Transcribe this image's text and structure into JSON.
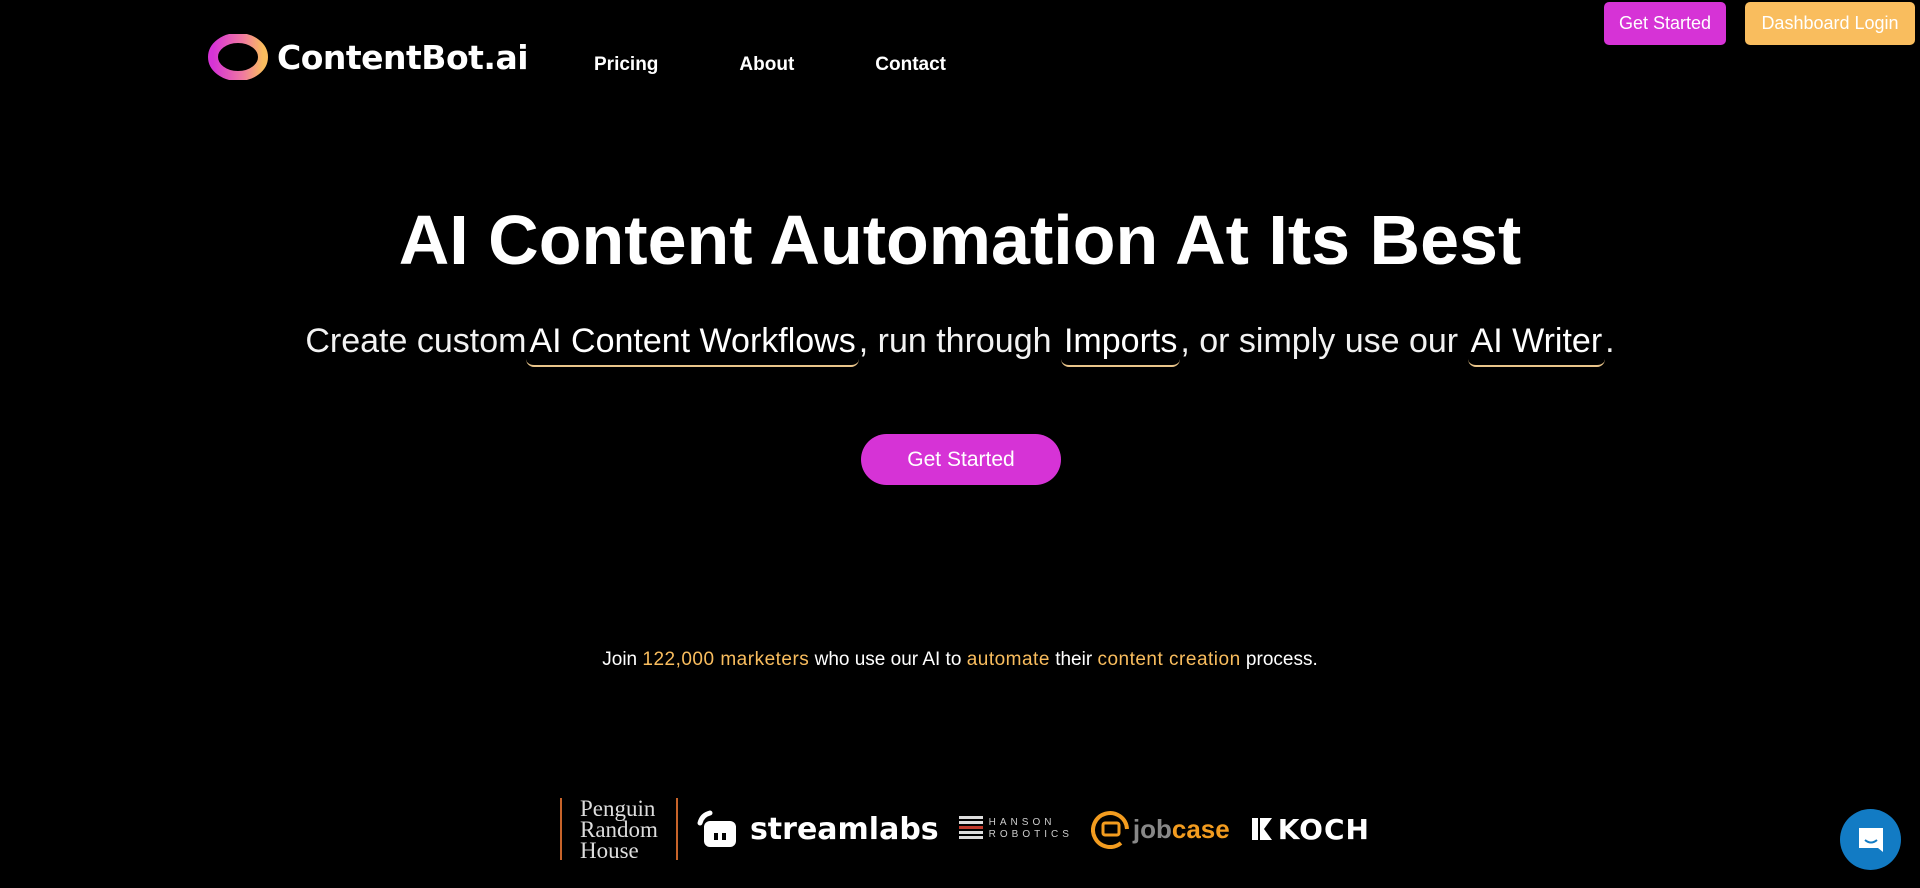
{
  "brand": {
    "name": "ContentBot.ai",
    "colors": {
      "primary": "#d633d6",
      "secondary": "#f9bd5e",
      "accent_text": "#f9bd5e",
      "chat": "#127bc4"
    }
  },
  "nav": {
    "items": [
      {
        "label": "Pricing"
      },
      {
        "label": "About"
      },
      {
        "label": "Contact"
      }
    ]
  },
  "header_buttons": {
    "get_started": "Get Started",
    "dashboard_login": "Dashboard Login"
  },
  "hero": {
    "title": "AI Content Automation At Its Best",
    "subtitle": {
      "part1": "Create custom",
      "link1": "AI Content Workflows",
      "part2": ", run through ",
      "link2": "Imports",
      "part3": ", or simply use our ",
      "link3": "AI Writer",
      "part4": "."
    },
    "cta_label": "Get Started"
  },
  "social_proof": {
    "t1": "Join ",
    "a1": "122,000 marketers",
    "t2": " who use our AI to ",
    "a2": "automate",
    "t3": " their ",
    "a3": "content creation",
    "t4": " process."
  },
  "client_logos": {
    "penguin": [
      "Penguin",
      "Random",
      "House"
    ],
    "streamlabs": "streamlabs",
    "hanson": [
      "HANSON",
      "ROBOTICS"
    ],
    "jobcase": {
      "job": "job",
      "case": "case"
    },
    "koch": "KOCH"
  },
  "chat_widget": {
    "icon": "chat-bubble-smile-icon"
  }
}
